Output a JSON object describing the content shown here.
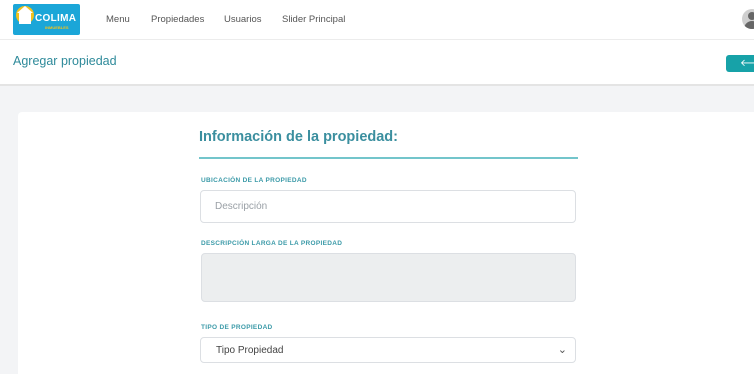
{
  "brand": {
    "name": "COLIMA",
    "tagline": "INMUEBLES",
    "colors": {
      "sky": "#1ba6d8",
      "sun": "#f3c21b"
    }
  },
  "nav": {
    "items": [
      {
        "label": "Menu"
      },
      {
        "label": "Propiedades"
      },
      {
        "label": "Usuarios"
      },
      {
        "label": "Slider Principal"
      }
    ]
  },
  "header": {
    "title": "Agregar propiedad",
    "back_icon": "arrow-left-icon",
    "back_glyph": "🡐"
  },
  "form": {
    "section_title": "Información de la propiedad:",
    "location": {
      "label": "UBICACIÓN DE LA PROPIEDAD",
      "placeholder": "Descripción",
      "value": ""
    },
    "long_description": {
      "label": "DESCRIPCIÓN LARGA DE LA PROPIEDAD",
      "value": ""
    },
    "type": {
      "label": "TIPO DE PROPIEDAD",
      "selected": "Tipo Propiedad",
      "chevron": "⌄"
    }
  },
  "theme": {
    "accent": "#17a2a8",
    "title": "#2e8a9a"
  }
}
